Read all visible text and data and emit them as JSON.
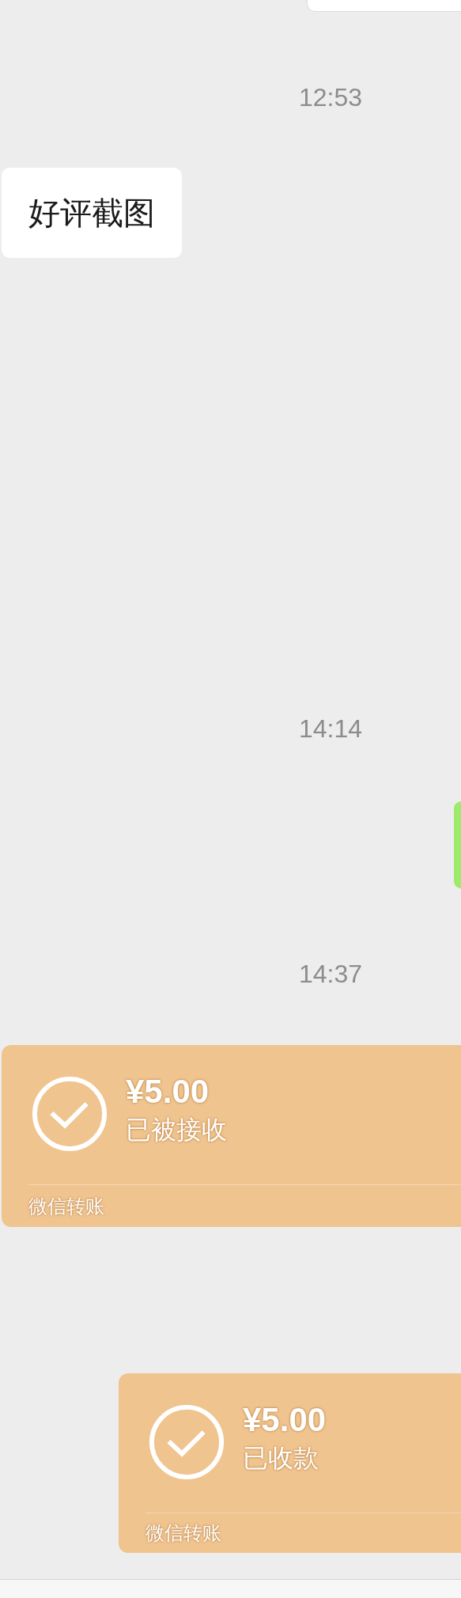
{
  "messages": [
    {
      "kind": "card_edge"
    },
    {
      "kind": "time",
      "text": "12:53"
    },
    {
      "kind": "text",
      "outgoing": false,
      "text": "好评截图"
    },
    {
      "kind": "time",
      "text": "14:14"
    },
    {
      "kind": "bubble_edge",
      "outgoing": true
    },
    {
      "kind": "time",
      "text": "14:37"
    },
    {
      "kind": "transfer",
      "outgoing": false,
      "amount": "¥5.00",
      "status": "已被接收",
      "footer": "微信转账"
    },
    {
      "kind": "transfer",
      "outgoing": true,
      "amount": "¥5.00",
      "status": "已收款",
      "footer": "微信转账"
    }
  ]
}
